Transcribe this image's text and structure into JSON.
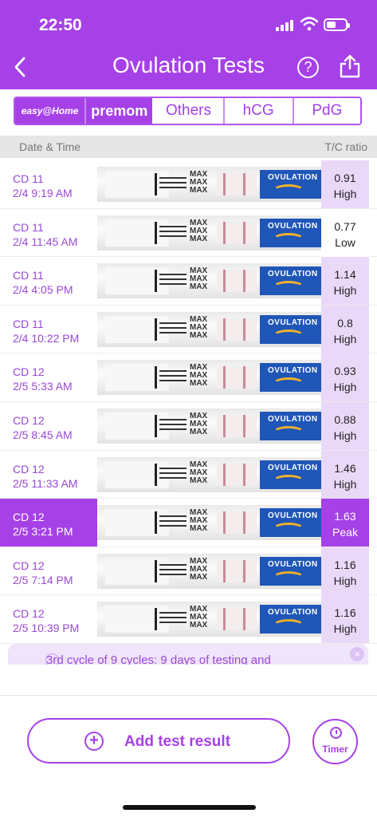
{
  "status": {
    "time": "22:50"
  },
  "header": {
    "title": "Ovulation Tests"
  },
  "tabs": [
    {
      "label": "easy@Home"
    },
    {
      "label": "premom"
    },
    {
      "label": "Others"
    },
    {
      "label": "hCG"
    },
    {
      "label": "PdG"
    }
  ],
  "columns": {
    "left": "Date & Time",
    "right": "T/C ratio"
  },
  "strip_text": {
    "max": "MAX",
    "brand": "OVULATION"
  },
  "rows": [
    {
      "cd": "CD 11",
      "datetime": "2/4 9:19 AM",
      "ratio": "0.91",
      "level": "High"
    },
    {
      "cd": "CD 11",
      "datetime": "2/4 11:45 AM",
      "ratio": "0.77",
      "level": "Low"
    },
    {
      "cd": "CD 11",
      "datetime": "2/4 4:05 PM",
      "ratio": "1.14",
      "level": "High"
    },
    {
      "cd": "CD 11",
      "datetime": "2/4 10:22 PM",
      "ratio": "0.8",
      "level": "High"
    },
    {
      "cd": "CD 12",
      "datetime": "2/5 5:33 AM",
      "ratio": "0.93",
      "level": "High"
    },
    {
      "cd": "CD 12",
      "datetime": "2/5 8:45 AM",
      "ratio": "0.88",
      "level": "High"
    },
    {
      "cd": "CD 12",
      "datetime": "2/5 11:33 AM",
      "ratio": "1.46",
      "level": "High"
    },
    {
      "cd": "CD 12",
      "datetime": "2/5 3:21 PM",
      "ratio": "1.63",
      "level": "Peak"
    },
    {
      "cd": "CD 12",
      "datetime": "2/5 7:14 PM",
      "ratio": "1.16",
      "level": "High"
    },
    {
      "cd": "CD 12",
      "datetime": "2/5 10:39 PM",
      "ratio": "1.16",
      "level": "High"
    }
  ],
  "banner": {
    "text": "3rd cycle of 9 cycles: 9 days of testing and"
  },
  "actions": {
    "add_label": "Add test result",
    "timer_label": "Timer"
  },
  "colors": {
    "accent": "#a641e8",
    "ratio_bg": "#ead8f9"
  }
}
